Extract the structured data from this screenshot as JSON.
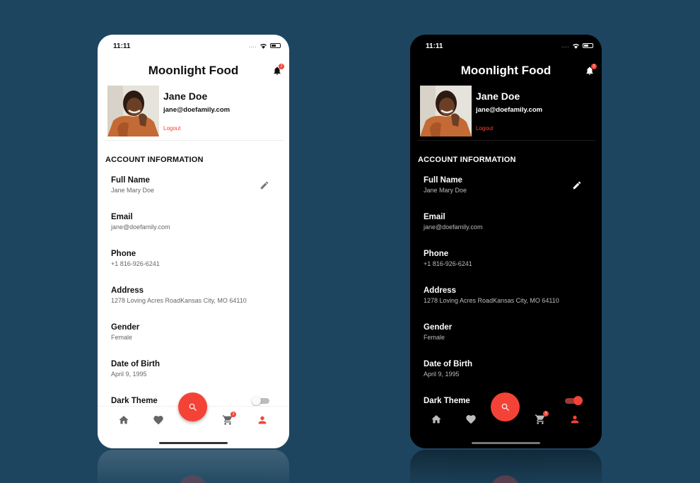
{
  "app": {
    "title": "Moonlight Food",
    "notification_count": "2",
    "cart_count": "3"
  },
  "status_bar": {
    "time": "11:11",
    "signal_dots": "....",
    "icons": [
      "wifi-icon",
      "battery-icon"
    ]
  },
  "profile": {
    "name": "Jane Doe",
    "email": "jane@doefamily.com",
    "logout_label": "Logout"
  },
  "account_section": {
    "title": "ACCOUNT INFORMATION",
    "items": [
      {
        "label": "Full Name",
        "value": "Jane Mary Doe"
      },
      {
        "label": "Email",
        "value": "jane@doefamily.com"
      },
      {
        "label": "Phone",
        "value": "+1 816-926-6241"
      },
      {
        "label": "Address",
        "value": "1278 Loving Acres RoadKansas City, MO 64110"
      },
      {
        "label": "Gender",
        "value": "Female"
      },
      {
        "label": "Date of Birth",
        "value": "April 9, 1995"
      }
    ]
  },
  "settings": {
    "dark_theme_label": "Dark Theme"
  },
  "screens": [
    {
      "theme": "light",
      "dark_theme_on": false
    },
    {
      "theme": "dark",
      "dark_theme_on": true
    }
  ],
  "bottom_nav": {
    "items": [
      "home-icon",
      "favorite-icon",
      "search-icon",
      "cart-icon",
      "person-icon"
    ],
    "active": "person-icon"
  },
  "colors": {
    "accent": "#f44336",
    "background": "#1d4560",
    "light_screen": "#ffffff",
    "dark_screen": "#000000"
  }
}
